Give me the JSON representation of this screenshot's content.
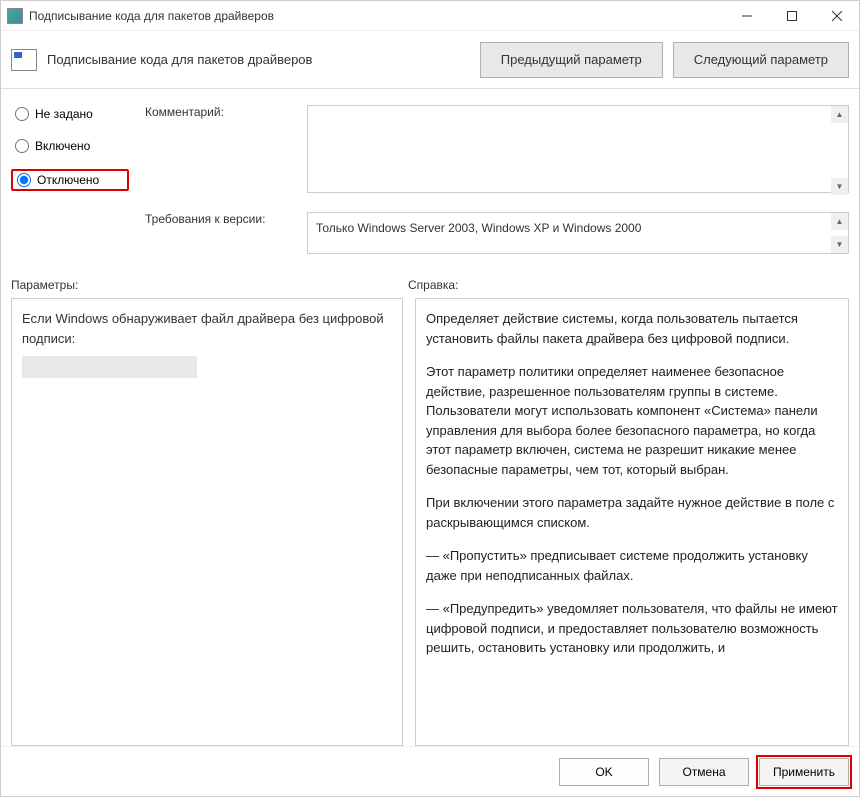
{
  "window": {
    "title": "Подписывание кода для пакетов драйверов"
  },
  "toolbar": {
    "title": "Подписывание кода для пакетов драйверов",
    "prev_label": "Предыдущий параметр",
    "next_label": "Следующий параметр"
  },
  "radios": {
    "not_set": "Не задано",
    "enabled": "Включено",
    "disabled": "Отключено",
    "selected": "disabled"
  },
  "fields": {
    "comment_label": "Комментарий:",
    "comment_value": "",
    "requirements_label": "Требования к версии:",
    "requirements_value": "Только Windows Server 2003, Windows XP и Windows 2000"
  },
  "sections": {
    "params_label": "Параметры:",
    "help_label": "Справка:"
  },
  "params": {
    "text": "Если Windows обнаруживает файл драйвера без цифровой подписи:"
  },
  "help": {
    "p1": "Определяет действие системы, когда пользователь пытается установить файлы пакета драйвера без цифровой подписи.",
    "p2": "Этот параметр политики определяет наименее безопасное действие, разрешенное пользователям группы в системе. Пользователи могут использовать компонент «Система» панели управления для выбора более безопасного параметра, но когда этот параметр включен, система не разрешит никакие менее безопасные параметры, чем тот, который выбран.",
    "p3": "При включении этого параметра задайте нужное действие в поле с раскрывающимся списком.",
    "p4": "—   «Пропустить» предписывает системе продолжить установку даже при неподписанных файлах.",
    "p5": "—   «Предупредить» уведомляет пользователя, что файлы не имеют цифровой подписи, и предоставляет пользователю возможность решить, остановить установку или продолжить, и"
  },
  "footer": {
    "ok": "OK",
    "cancel": "Отмена",
    "apply": "Применить"
  }
}
